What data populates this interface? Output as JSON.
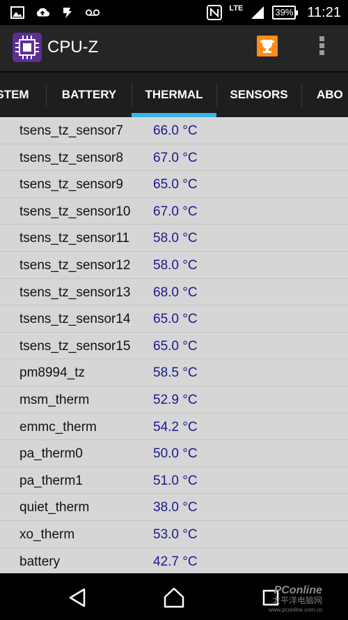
{
  "status_bar": {
    "network": "LTE",
    "battery": "39%",
    "time": "11:21"
  },
  "app": {
    "title": "CPU-Z"
  },
  "tabs": [
    {
      "label": "STEM"
    },
    {
      "label": "BATTERY"
    },
    {
      "label": "THERMAL",
      "selected": true
    },
    {
      "label": "SENSORS"
    },
    {
      "label": "ABO"
    }
  ],
  "thermal": {
    "rows": [
      {
        "name": "tsens_tz_sensor7",
        "value": "66.0 °C"
      },
      {
        "name": "tsens_tz_sensor8",
        "value": "67.0 °C"
      },
      {
        "name": "tsens_tz_sensor9",
        "value": "65.0 °C"
      },
      {
        "name": "tsens_tz_sensor10",
        "value": "67.0 °C"
      },
      {
        "name": "tsens_tz_sensor11",
        "value": "58.0 °C"
      },
      {
        "name": "tsens_tz_sensor12",
        "value": "58.0 °C"
      },
      {
        "name": "tsens_tz_sensor13",
        "value": "68.0 °C"
      },
      {
        "name": "tsens_tz_sensor14",
        "value": "65.0 °C"
      },
      {
        "name": "tsens_tz_sensor15",
        "value": "65.0 °C"
      },
      {
        "name": "pm8994_tz",
        "value": "58.5 °C"
      },
      {
        "name": "msm_therm",
        "value": "52.9 °C"
      },
      {
        "name": "emmc_therm",
        "value": "54.2 °C"
      },
      {
        "name": "pa_therm0",
        "value": "50.0 °C"
      },
      {
        "name": "pa_therm1",
        "value": "51.0 °C"
      },
      {
        "name": "quiet_therm",
        "value": "38.0 °C"
      },
      {
        "name": "xo_therm",
        "value": "53.0 °C"
      },
      {
        "name": "battery",
        "value": "42.7 °C"
      }
    ]
  },
  "watermark": {
    "brand": "PConline",
    "sub": "太平洋电脑网",
    "url": "www.pconline.com.cn"
  },
  "colors": {
    "tab_indicator": "#33b5e5",
    "value_text": "#1a1a8c",
    "app_logo": "#5a2f96",
    "trophy": "#ff8c1a"
  }
}
